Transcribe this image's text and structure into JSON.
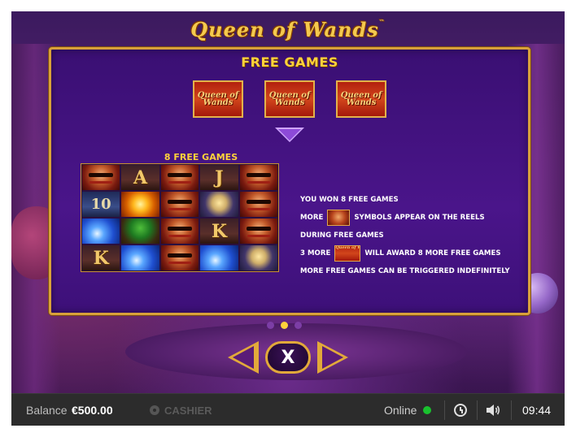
{
  "game": {
    "logo": "Queen of Wands",
    "logo_tm": "™"
  },
  "paytable": {
    "title": "FREE GAMES",
    "scatter_symbol_text": "Queen of Wands",
    "scatter_count": 3,
    "reels_caption": "8 FREE GAMES",
    "reels": [
      [
        "queen",
        "A",
        "queen",
        "J",
        "queen"
      ],
      [
        "10",
        "sun",
        "queen",
        "chalice",
        "queen"
      ],
      [
        "wave",
        "tree",
        "queen",
        "K",
        "queen"
      ],
      [
        "K",
        "wave",
        "queen",
        "wave",
        "chalice"
      ]
    ],
    "info": {
      "line1": "YOU WON 8 FREE GAMES",
      "line2_pre": "MORE",
      "line2_post": "SYMBOLS APPEAR ON THE REELS",
      "line3": "DURING FREE GAMES",
      "line4_pre": "3 MORE",
      "line4_post": "WILL AWARD 8 MORE FREE GAMES",
      "line5": "MORE FREE GAMES CAN BE TRIGGERED INDEFINITELY",
      "mini_scatter_text": "Queen of Wands"
    }
  },
  "pagination": {
    "pages": 3,
    "active_index": 1
  },
  "controls": {
    "close_label": "X"
  },
  "statusbar": {
    "balance_label": "Balance",
    "balance_value": "€500.00",
    "cashier_label": "CASHIER",
    "online_label": "Online",
    "time": "09:44",
    "online_color": "#19c22e"
  },
  "icons": [
    "cashier-icon",
    "online-status-icon",
    "clock-icon",
    "volume-icon",
    "arrow-down-icon"
  ]
}
